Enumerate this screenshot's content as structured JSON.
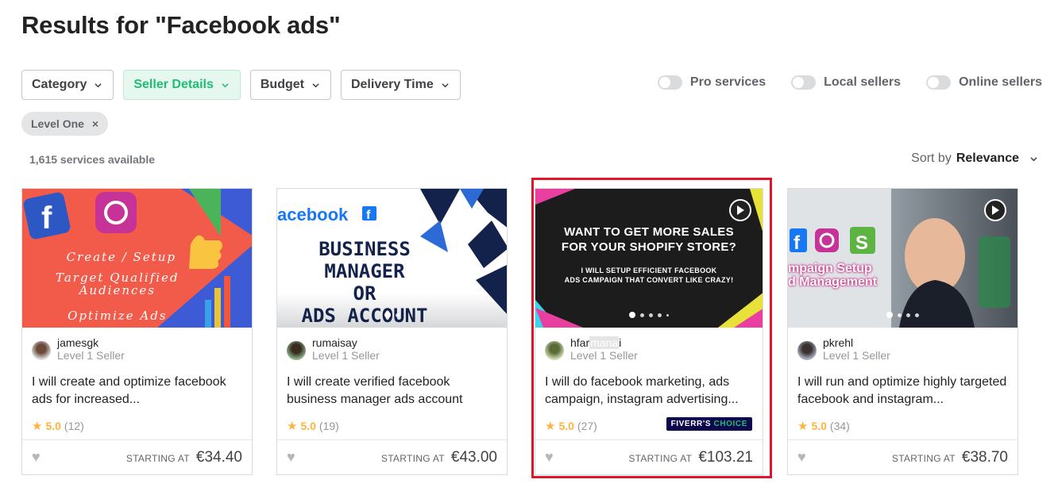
{
  "title": "Results for \"Facebook ads\"",
  "filters": [
    {
      "label": "Category",
      "active": false
    },
    {
      "label": "Seller Details",
      "active": true
    },
    {
      "label": "Budget",
      "active": false
    },
    {
      "label": "Delivery Time",
      "active": false
    }
  ],
  "toggles": [
    {
      "label": "Pro services"
    },
    {
      "label": "Local sellers"
    },
    {
      "label": "Online sellers"
    }
  ],
  "chip": {
    "label": "Level One",
    "remove": "×"
  },
  "count": "1,615 services available",
  "sort": {
    "prefix": "Sort by",
    "value": "Relevance"
  },
  "cards": [
    {
      "seller": "jamesgk",
      "level": "Level 1 Seller",
      "title": "I will create and optimize facebook ads for increased...",
      "score": "5.0",
      "reviews": "(12)",
      "starting": "STARTING AT",
      "price": "€34.40",
      "image_text": [
        "Create / Setup",
        "Target Qualified",
        "Audiences",
        "Optimize Ads"
      ]
    },
    {
      "seller": "rumaisay",
      "level": "Level 1 Seller",
      "title": "I will create verified facebook business manager ads account",
      "score": "5.0",
      "reviews": "(19)",
      "starting": "STARTING AT",
      "price": "€43.00",
      "image_text": [
        "acebook",
        "BUSINESS MANAGER",
        "OR",
        "ADS ACCOUNT"
      ]
    },
    {
      "seller_a": "hfar",
      "seller_b": "mana",
      "seller_c": "i",
      "level": "Level 1 Seller",
      "title": "I will do facebook marketing, ads campaign, instagram advertising...",
      "score": "5.0",
      "reviews": "(27)",
      "starting": "STARTING AT",
      "price": "€103.21",
      "badge_a": "FIVERR'S",
      "badge_b": "CHOICE",
      "image_text": [
        "WANT TO GET MORE SALES",
        "FOR YOUR SHOPIFY STORE?",
        "I WILL SETUP EFFICIENT FACEBOOK",
        "ADS CAMPAIGN THAT CONVERT LIKE CRAZY!"
      ]
    },
    {
      "seller": "pkrehl",
      "level": "Level 1 Seller",
      "title": "I will run and optimize highly targeted facebook and instagram...",
      "score": "5.0",
      "reviews": "(34)",
      "starting": "STARTING AT",
      "price": "€38.70",
      "image_text": [
        "mpaign Setup",
        "d Management"
      ]
    }
  ],
  "colors": {
    "accent": "#1dbf73",
    "star": "#ffb33e",
    "highlight": "#e0142b"
  }
}
